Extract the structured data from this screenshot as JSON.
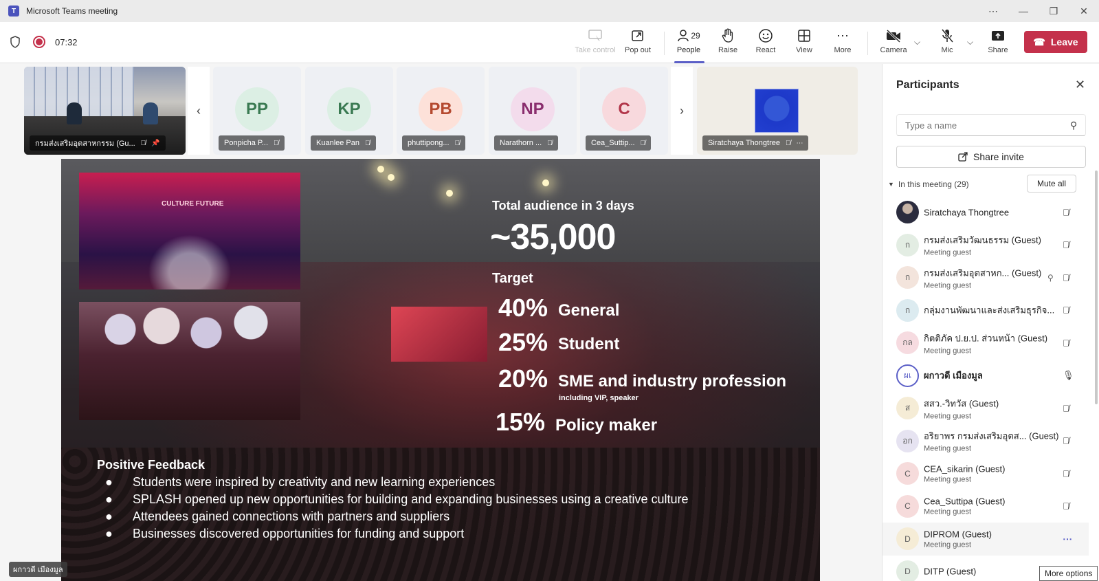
{
  "window": {
    "title": "Microsoft Teams meeting",
    "controls": [
      "⋯",
      "—",
      "❐",
      "✕"
    ]
  },
  "toolbar": {
    "timer": "07:32",
    "take_control": "Take control",
    "pop_out": "Pop out",
    "people": "People",
    "people_count": "29",
    "raise": "Raise",
    "react": "React",
    "view": "View",
    "more": "More",
    "camera": "Camera",
    "mic": "Mic",
    "share": "Share",
    "leave": "Leave",
    "leave_color": "#c4314b"
  },
  "strip": {
    "room_name": "กรมส่งเสริมอุตสาหกรรม (Gu...",
    "tiles": [
      {
        "initials": "PP",
        "name": "Ponpicha P...",
        "bg": "#dcefe4",
        "fg": "#3a7a52"
      },
      {
        "initials": "KP",
        "name": "Kuanlee Pan",
        "bg": "#dcefe4",
        "fg": "#3a7a52"
      },
      {
        "initials": "PB",
        "name": "phuttipong...",
        "bg": "#fde1d9",
        "fg": "#b54a30"
      },
      {
        "initials": "NP",
        "name": "Narathorn ...",
        "bg": "#f3dcec",
        "fg": "#8a2e6e"
      },
      {
        "initials": "C",
        "name": "Cea_Suttip...",
        "bg": "#f8d9dd",
        "fg": "#b2364a"
      }
    ],
    "sira_name": "Siratchaya Thongtree"
  },
  "slide": {
    "photo_text": "CULTURE FUTURE",
    "audience_label": "Total audience in 3 days",
    "audience_value": "~35,000",
    "target_label": "Target",
    "targets": [
      {
        "pct": "40%",
        "label": "General",
        "sub": ""
      },
      {
        "pct": "25%",
        "label": "Student",
        "sub": ""
      },
      {
        "pct": "20%",
        "label": "SME and industry profession",
        "sub": "including VIP, speaker"
      },
      {
        "pct": "15%",
        "label": "Policy maker",
        "sub": ""
      }
    ],
    "feedback_title": "Positive Feedback",
    "bullet_char": "●",
    "feedback": [
      "Students were inspired by creativity and new learning experiences",
      "SPLASH opened up new opportunities for building and expanding businesses using a creative culture",
      "Attendees gained connections with partners and suppliers",
      "Businesses discovered opportunities for funding and support"
    ]
  },
  "self_view_name": "ผกาวดี เมืองมูล",
  "panel": {
    "title": "Participants",
    "search_placeholder": "Type a name",
    "share_invite": "Share invite",
    "section_label": "In this meeting (29)",
    "mute_all": "Mute all",
    "tooltip": "More options",
    "participants": [
      {
        "initials": "",
        "name": "Siratchaya Thongtree",
        "sub": "",
        "avatar": "photo",
        "bg": "#2b2c3e",
        "mic": "off"
      },
      {
        "initials": "ก",
        "name": "กรมส่งเสริมวัฒนธรรม (Guest)",
        "sub": "Meeting guest",
        "bg": "#e3ede3",
        "mic": "off"
      },
      {
        "initials": "ก",
        "name": "กรมส่งเสริมอุตสาหก... (Guest)",
        "sub": "Meeting guest",
        "bg": "#f3e4dc",
        "mic": "off",
        "pinned": true
      },
      {
        "initials": "ก",
        "name": "กลุ่มงานพัฒนาและส่งเสริมธุรกิจ...",
        "sub": "",
        "bg": "#dcebf0",
        "mic": "off"
      },
      {
        "initials": "กล",
        "name": "กิตติภัค ป.ย.ป. ส่วนหน้า (Guest)",
        "sub": "Meeting guest",
        "bg": "#f6dbe0",
        "mic": "off"
      },
      {
        "initials": "ผเ",
        "name": "ผกาวดี เมืองมูล",
        "sub": "",
        "bg": "#ffffff",
        "mic": "on",
        "bold": true,
        "speaking": true
      },
      {
        "initials": "ส",
        "name": "สสว.-วิทวัส (Guest)",
        "sub": "Meeting guest",
        "bg": "#f5ecd6",
        "mic": "off"
      },
      {
        "initials": "อก",
        "name": "อริยาพร กรมส่งเสริมอุตส... (Guest)",
        "sub": "Meeting guest",
        "bg": "#e6e3f1",
        "mic": "off"
      },
      {
        "initials": "C",
        "name": "CEA_sikarin (Guest)",
        "sub": "Meeting guest",
        "bg": "#f6dbdb",
        "mic": "off"
      },
      {
        "initials": "C",
        "name": "Cea_Suttipa (Guest)",
        "sub": "Meeting guest",
        "bg": "#f6dbdb",
        "mic": "off"
      },
      {
        "initials": "D",
        "name": "DIPROM (Guest)",
        "sub": "Meeting guest",
        "bg": "#f5ecd6",
        "mic": "more",
        "hover": true
      },
      {
        "initials": "D",
        "name": "DITP (Guest)",
        "sub": "",
        "bg": "#e3ede3",
        "mic": ""
      }
    ]
  }
}
